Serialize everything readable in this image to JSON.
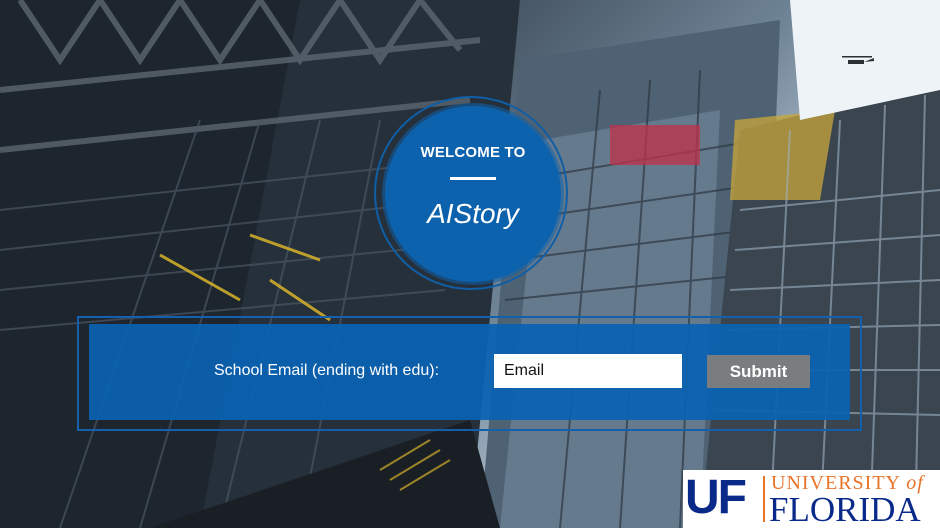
{
  "welcome": {
    "title": "WELCOME TO",
    "brand": "AIStory"
  },
  "form": {
    "label": "School Email (ending with edu):",
    "email_placeholder": "Email",
    "submit_label": "Submit"
  },
  "logo": {
    "mark": "UF",
    "line1": "UNIVERSITY",
    "line1_of": "of",
    "line2": "FLORIDA"
  },
  "colors": {
    "brand_blue": "#0d62ad",
    "uf_blue": "#0a2a8a",
    "uf_orange": "#e8742a",
    "submit_gray": "#7a7d80"
  }
}
